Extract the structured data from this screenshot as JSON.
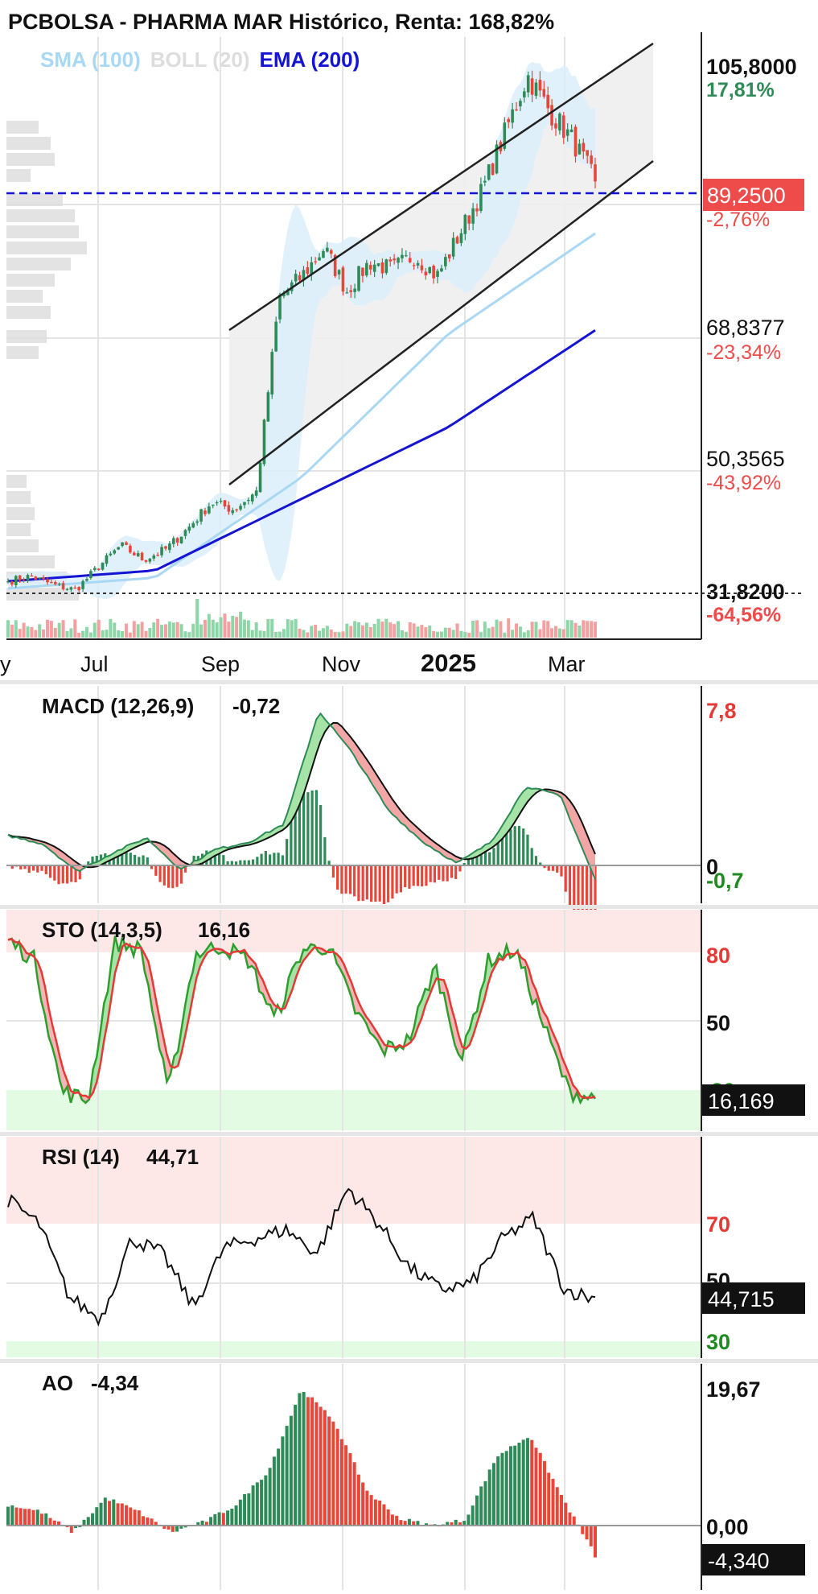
{
  "header": {
    "title": "PCBOLSA - PHARMA MAR Histórico, Renta: 168,82%",
    "legend": [
      {
        "label": "SMA (100)",
        "color": "#a9d8f5"
      },
      {
        "label": "BOLL (20)",
        "color": "#dddddd"
      },
      {
        "label": "EMA (200)",
        "color": "#1414d2"
      }
    ]
  },
  "colors": {
    "up": "#2e8b57",
    "down": "#e8463a",
    "upVolume": "#8ed6a8",
    "downVolume": "#f5a0a0",
    "sma": "#a9d8f5",
    "ema": "#1414d2",
    "bollFill": "#dceefa",
    "channelFill": "#eeeeee",
    "priceLine": "#1414d2",
    "priceTag": "#ee4b4b"
  },
  "price_axis": {
    "levels": [
      {
        "value": "105,8000",
        "pct": "17,81%",
        "pct_color": "#2e8b57",
        "bold": true
      },
      {
        "value": "68,8377",
        "pct": "-23,34%",
        "pct_color": "#ee4b4b",
        "bold": false
      },
      {
        "value": "50,3565",
        "pct": "-43,92%",
        "pct_color": "#ee4b4b",
        "bold": false
      },
      {
        "value": "31,8200",
        "pct": "-64,56%",
        "pct_color": "#ee4b4b",
        "bold": true
      }
    ],
    "current": {
      "value": "89,2500",
      "pct": "-2,76%"
    }
  },
  "x_axis": {
    "labels": [
      {
        "text": "y",
        "bold": false
      },
      {
        "text": "Jul",
        "bold": false
      },
      {
        "text": "Sep",
        "bold": false
      },
      {
        "text": "Nov",
        "bold": false
      },
      {
        "text": "2025",
        "bold": true
      },
      {
        "text": "Mar",
        "bold": false
      }
    ]
  },
  "panels": {
    "macd": {
      "name": "MACD (12,26,9)",
      "value": "-0,72",
      "top_label": "7,8",
      "zero_label": "0",
      "cur_label": "-0,7"
    },
    "sto": {
      "name": "STO (14,3,5)",
      "value": "16,16",
      "levels": [
        "80",
        "50",
        "20"
      ],
      "cur_label": "16,169"
    },
    "rsi": {
      "name": "RSI (14)",
      "value": "44,71",
      "levels": [
        "70",
        "50",
        "30"
      ],
      "cur_label": "44,715"
    },
    "ao": {
      "name": "AO",
      "value": "-4,34",
      "top_label": "19,67",
      "zero_label": "0,00",
      "cur_label": "-4,340"
    }
  },
  "chart_data": [
    {
      "type": "candlestick",
      "title": "PCBOLSA - PHARMA MAR Histórico, Renta: 168,82%",
      "x": [
        "May 2024",
        "Jul 2024",
        "Sep 2024",
        "Nov 2024",
        "Jan 2025",
        "Mar 2025"
      ],
      "close_path": [
        [
          "Jun 2024",
          33.5
        ],
        [
          "Jul 2024",
          32.3
        ],
        [
          "Aug 2024",
          38.5
        ],
        [
          "Sep 2024",
          38.0
        ],
        [
          "Oct 2024",
          44.0
        ],
        [
          "Oct 2024 (gap)",
          73.0
        ],
        [
          "Nov 2024",
          80.0
        ],
        [
          "Dec 2024",
          77.0
        ],
        [
          "Jan 2025",
          90.0
        ],
        [
          "Feb 2025",
          104.0
        ],
        [
          "Mar 2025",
          89.25
        ]
      ],
      "series": [
        {
          "name": "SMA (100)",
          "values": [
            [
              "Jun 2024",
              32.5
            ],
            [
              "Sep 2024",
              34.0
            ],
            [
              "Nov 2024",
              48.0
            ],
            [
              "Jan 2025",
              68.0
            ],
            [
              "Mar 2025",
              82.0
            ]
          ]
        },
        {
          "name": "EMA (200)",
          "values": [
            [
              "Jun 2024",
              33.5
            ],
            [
              "Sep 2024",
              35.0
            ],
            [
              "Nov 2024",
              45.0
            ],
            [
              "Jan 2025",
              55.0
            ],
            [
              "Mar 2025",
              68.5
            ]
          ]
        }
      ],
      "ylim": [
        30.0,
        107.0
      ],
      "price_labels": [
        "105,8000",
        "89,2500",
        "68,8377",
        "50,3565",
        "31,8200"
      ]
    },
    {
      "type": "line",
      "title": "MACD (12,26,9)",
      "current_value": -0.72,
      "ylim": [
        -1.0,
        7.8
      ],
      "values": [
        1.5,
        1.1,
        -0.3,
        0.6,
        1.4,
        -0.2,
        0.8,
        1.2,
        2.1,
        7.8,
        5.6,
        2.8,
        1.2,
        0.1,
        1.2,
        4.0,
        3.5,
        -0.72
      ]
    },
    {
      "type": "line",
      "title": "STO (14,3,5)",
      "current_value": 16.16,
      "ylim": [
        0,
        100
      ],
      "levels": [
        80,
        50,
        20
      ],
      "values": [
        95,
        85,
        20,
        15,
        94,
        90,
        18,
        88,
        92,
        85,
        55,
        90,
        92,
        60,
        40,
        45,
        82,
        35,
        85,
        90,
        55,
        20,
        16.16
      ]
    },
    {
      "type": "line",
      "title": "RSI (14)",
      "current_value": 44.71,
      "ylim": [
        25,
        85
      ],
      "levels": [
        70,
        50,
        30
      ],
      "values": [
        78,
        70,
        45,
        38,
        65,
        60,
        42,
        62,
        65,
        68,
        60,
        82,
        70,
        55,
        48,
        50,
        65,
        72,
        48,
        44.71
      ]
    },
    {
      "type": "bar",
      "title": "AO",
      "current_value": -4.34,
      "ylim": [
        -6,
        19.67
      ],
      "values": [
        3,
        2,
        -1,
        4,
        2,
        -1,
        0.5,
        3,
        8,
        19.67,
        15,
        5,
        1,
        0,
        0.8,
        10,
        13,
        4,
        -4.34
      ]
    }
  ]
}
